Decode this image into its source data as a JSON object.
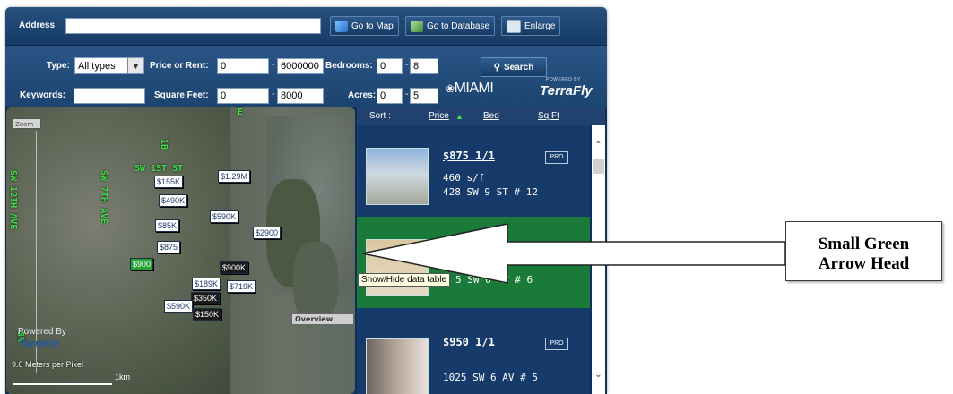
{
  "toolbar": {
    "address_label": "Address",
    "address_value": "",
    "go_to_map_label": "Go to Map",
    "go_to_database_label": "Go to Database",
    "enlarge_label": "Enlarge"
  },
  "filters": {
    "type_label": "Type:",
    "type_value": "All types",
    "price_label": "Price or Rent:",
    "price_min": "0",
    "price_max": "6000000",
    "bedrooms_label": "Bedrooms:",
    "bedrooms_min": "0",
    "bedrooms_max": "8",
    "search_label": "Search",
    "keywords_label": "Keywords:",
    "keywords_value": "",
    "sqft_label": "Square Feet:",
    "sqft_min": "0",
    "sqft_max": "8000",
    "acres_label": "Acres:",
    "acres_min": "0",
    "acres_max": "5",
    "dash": "-"
  },
  "branding": {
    "miami": "MIAMI",
    "powered_by": "POWERED BY",
    "terrafly": "TerraFly"
  },
  "map": {
    "zoom_label": "Zoom",
    "overview_label": "Overview",
    "powered_by": "Powered By",
    "terrafly": "TerraFly",
    "scale_text": "9.6 Meters per Pixel",
    "scale_unit": "1km",
    "streets": [
      "SW 1ST ST",
      "SW 7TH AVE",
      "SW 12TH AVE",
      "1B",
      "E",
      "SR"
    ],
    "price_pins": [
      "$1.29M",
      "$155K",
      "$490K",
      "$590K",
      "$85K",
      "$2900",
      "$875",
      "$900",
      "$900K",
      "$189K",
      "$719K",
      "$350K",
      "$590K",
      "$150K"
    ]
  },
  "list": {
    "sort_label": "Sort :",
    "sort_price": "Price",
    "sort_bed": "Bed",
    "sort_sqft": "Sq Ft",
    "items": [
      {
        "price": "$875 1/1",
        "badge": "PRO",
        "line1": "460 s/f",
        "line2": "428 SW 9 ST # 12"
      },
      {
        "price": "",
        "badge": "",
        "line1": "",
        "line2": "5 SW 6 AV # 6"
      },
      {
        "price": "$950 1/1",
        "badge": "PRO",
        "line1": "",
        "line2": "1025 SW 6 AV # 5"
      }
    ]
  },
  "tooltip": "Show/Hide data table",
  "callout": {
    "line1": "Small Green",
    "line2": "Arrow Head"
  },
  "colors": {
    "panel_dark": "#0f2f55",
    "list_bg": "#132f56",
    "selected_row": "#1a7a3a",
    "accent_green": "#41e046"
  }
}
